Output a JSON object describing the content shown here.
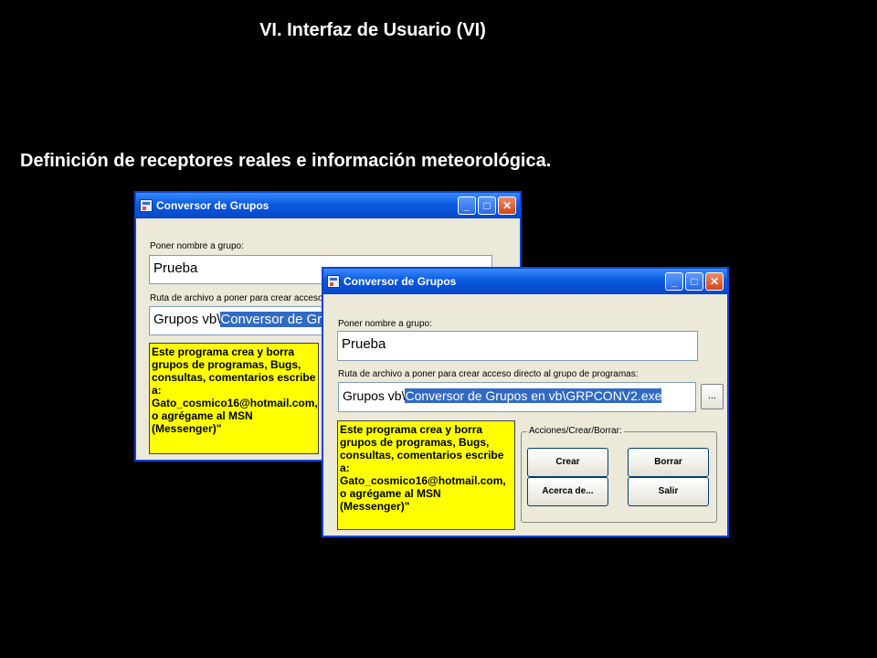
{
  "slide": {
    "title": "VI. Interfaz de Usuario (VI)",
    "subtitle": "Definición de receptores reales e información meteorológica."
  },
  "window_back": {
    "title": "Conversor de Grupos",
    "group_name_label": "Poner nombre a grupo:",
    "group_name_value": "Prueba",
    "path_label": "Ruta de archivo a poner para crear acceso directo",
    "path_prefix": "Grupos vb\\",
    "path_selected": "Conversor de Grup",
    "info_text": "Este programa crea y borra\ngrupos de programas, Bugs,\nconsultas, comentarios escribe\na:\nGato_cosmico16@hotmail.com,\no agrégame al MSN\n(Messenger)\""
  },
  "window_front": {
    "title": "Conversor de Grupos",
    "group_name_label": "Poner nombre a grupo:",
    "group_name_value": "Prueba",
    "path_label": "Ruta de archivo a poner para crear acceso directo al grupo de programas:",
    "path_prefix": "Grupos vb\\",
    "path_selected": "Conversor de Grupos en vb\\GRPCONV2.exe",
    "browse_label": "...",
    "info_text": "Este programa crea y borra\ngrupos de programas, Bugs,\nconsultas, comentarios escribe\na:\nGato_cosmico16@hotmail.com,\no agrégame al MSN\n(Messenger)\"",
    "groupbox_label": "Acciones/Crear/Borrar:",
    "buttons": {
      "crear": "Crear",
      "borrar": "Borrar",
      "acerca": "Acerca de...",
      "salir": "Salir"
    }
  },
  "window_controls": {
    "minimize": "_",
    "maximize": "□",
    "close": "✕"
  },
  "icons": {
    "app": "app-icon"
  },
  "colors": {
    "titlebar": "#0a5ae0",
    "window_bg": "#ece9d8",
    "selection": "#316ac5",
    "info_bg": "#ffff00"
  }
}
